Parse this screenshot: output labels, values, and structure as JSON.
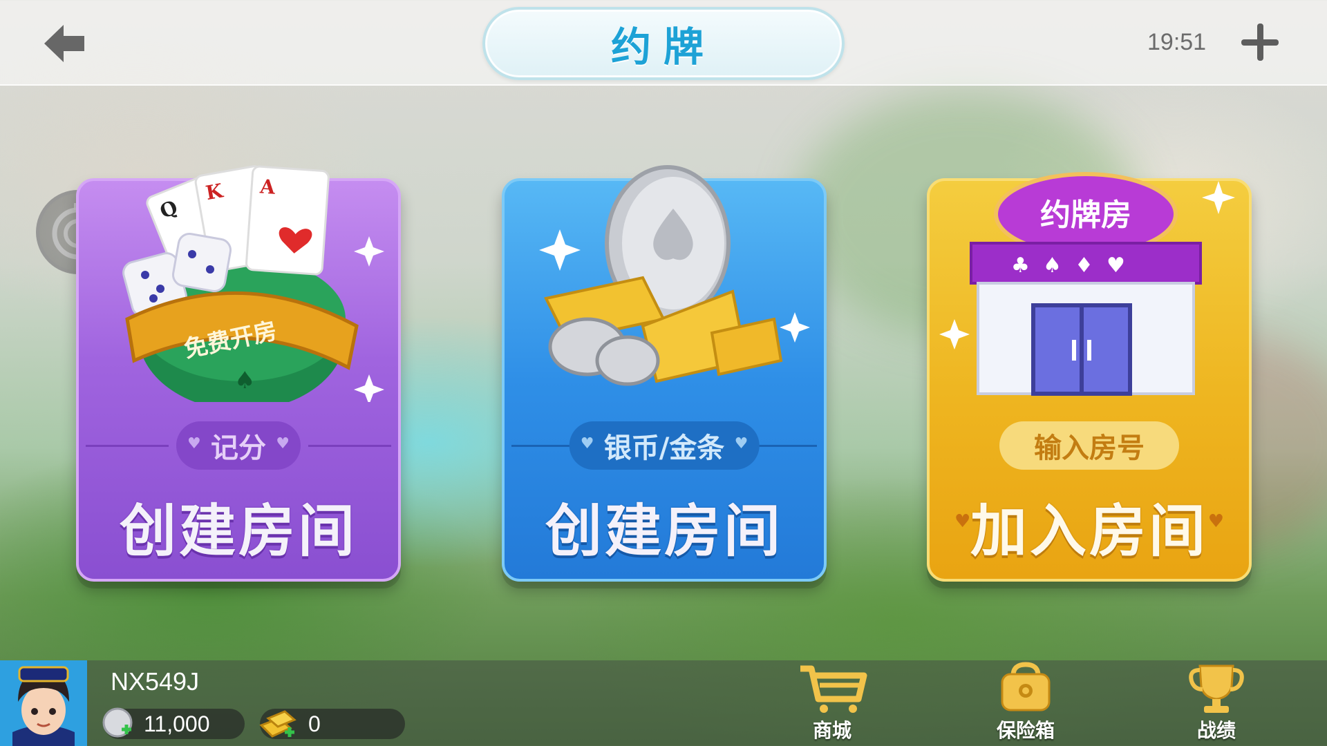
{
  "header": {
    "title": "约牌",
    "time": "19:51"
  },
  "cards": [
    {
      "badge": "免费开房",
      "tag": "记分",
      "title": "创建房间",
      "color": "#a064df"
    },
    {
      "badge": "",
      "tag": "银币/金条",
      "title": "创建房间",
      "color": "#2f8fe7"
    },
    {
      "badge": "约牌房",
      "tag": "输入房号",
      "title": "加入房间",
      "color": "#eeb520"
    }
  ],
  "player": {
    "name": "NX549J",
    "silver": "11,000",
    "gold": "0"
  },
  "bottom_nav": [
    {
      "label": "商城",
      "icon": "cart-icon"
    },
    {
      "label": "保险箱",
      "icon": "safe-icon"
    },
    {
      "label": "战绩",
      "icon": "trophy-icon"
    }
  ]
}
